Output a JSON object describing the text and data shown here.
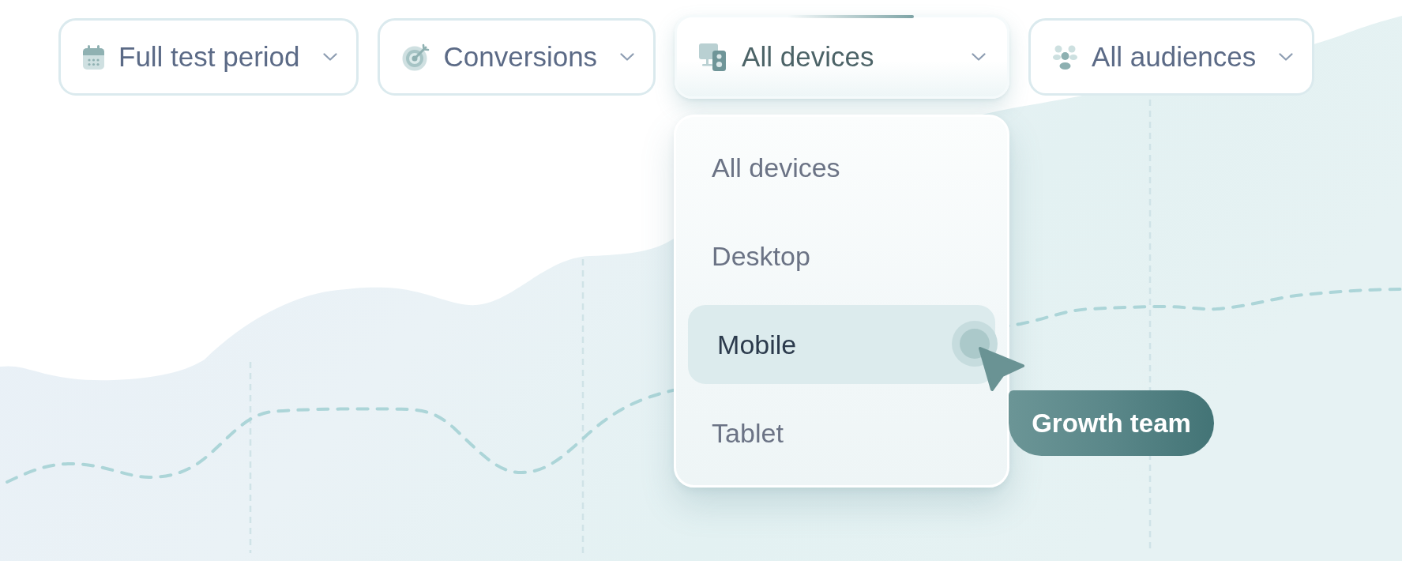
{
  "filters": [
    {
      "kind": "calendar",
      "label": "Full test period",
      "open": false
    },
    {
      "kind": "target",
      "label": "Conversions",
      "open": false
    },
    {
      "kind": "devices",
      "label": "All devices",
      "open": true,
      "options": [
        {
          "label": "All devices",
          "highlighted": false
        },
        {
          "label": "Desktop",
          "highlighted": false
        },
        {
          "label": "Mobile",
          "highlighted": true
        },
        {
          "label": "Tablet",
          "highlighted": false
        }
      ]
    },
    {
      "kind": "audience",
      "label": "All audiences",
      "open": false
    }
  ],
  "cursor": {
    "label": "Growth team"
  }
}
